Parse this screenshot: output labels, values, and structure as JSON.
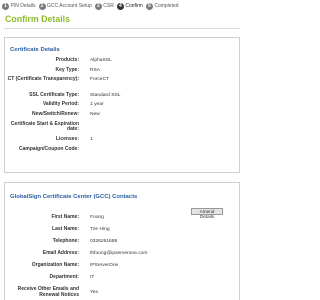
{
  "steps": [
    {
      "num": "1",
      "label": "PIN Details"
    },
    {
      "num": "2",
      "label": "GCC Account Setup"
    },
    {
      "num": "3",
      "label": "CSR"
    },
    {
      "num": "4",
      "label": "Confirm"
    },
    {
      "num": "5",
      "label": "Completed"
    }
  ],
  "active_step": "4",
  "page_title": "Confirm Details",
  "certificate": {
    "title": "Certificate Details",
    "rows": [
      {
        "label": "Products:",
        "value": "AlphaSSL"
      },
      {
        "label": "Key Type:",
        "value": "RSA"
      },
      {
        "label": "CT (Certificate Transparency):",
        "value": "ForceCT"
      },
      {
        "label": "SSL Certificate Type:",
        "value": "Standard SSL"
      },
      {
        "label": "Validity Period:",
        "value": "1 year"
      },
      {
        "label": "New/Switch/Renew:",
        "value": "New"
      },
      {
        "label": "Certificate Start & Expiration date:",
        "value": ""
      },
      {
        "label": "Licenses:",
        "value": "1"
      },
      {
        "label": "Campaign/Coupon Code:",
        "value": ""
      }
    ]
  },
  "contacts": {
    "title": "GlobalSign Certificate Center (GCC) Contacts",
    "amend_label": "Amend Details",
    "rows": [
      {
        "label": "First Name:",
        "value": "Foong"
      },
      {
        "label": "Last Name:",
        "value": "Tze Hing"
      },
      {
        "label": "Telephone:",
        "value": "0326261688"
      },
      {
        "label": "Email Address:",
        "value": "thfoong@ipserverone.com"
      },
      {
        "label": "Organization Name:",
        "value": "IPServerOne"
      },
      {
        "label": "Department:",
        "value": "IT"
      },
      {
        "label": "Receive Other Emails and Renewal Notices",
        "value": "Yes"
      }
    ]
  },
  "colors": {
    "title_green": "#8fbd2a",
    "section_blue": "#2b5fa3",
    "step_active": "#333333",
    "step_inactive": "#7a7a7a"
  }
}
